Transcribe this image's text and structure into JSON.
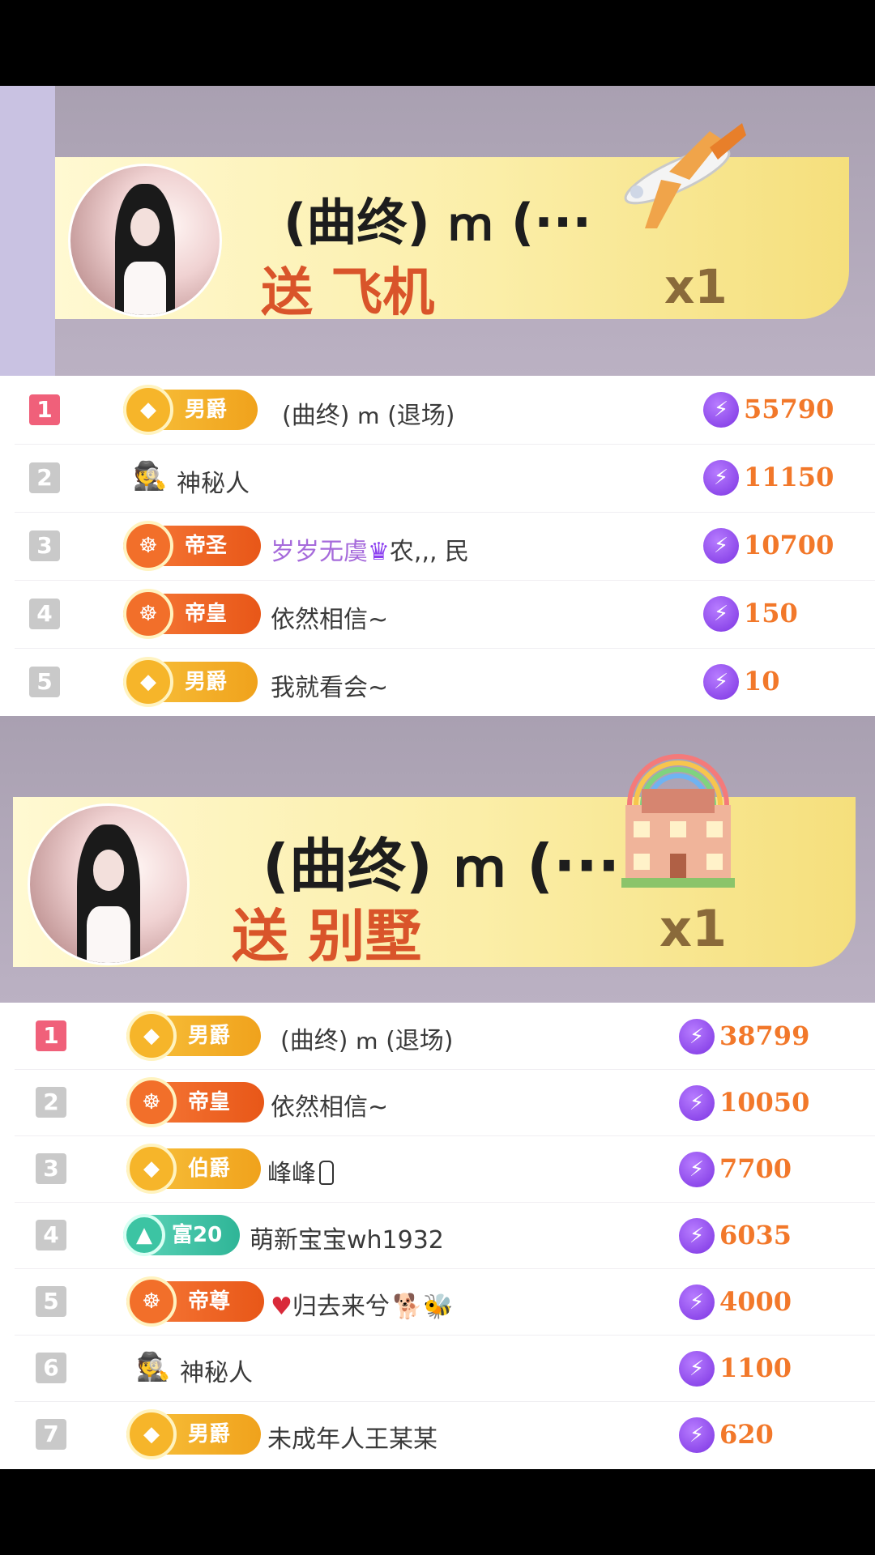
{
  "banners": [
    {
      "title": "(曲终) ՠ (···",
      "send_text": "送 飞机",
      "count": "x1",
      "gift_icon": "airplane-gift"
    },
    {
      "title": "(曲终) ՠ (···",
      "send_text": "送 别墅",
      "count": "x1",
      "gift_icon": "villa-gift"
    }
  ],
  "list1": [
    {
      "rank": "1",
      "badge": "男爵",
      "badge_style": "gold",
      "name": "(曲终) ՠ (退场)",
      "score": "55790"
    },
    {
      "rank": "2",
      "badge": "",
      "badge_style": "spy",
      "name": "神秘人",
      "score": "11150"
    },
    {
      "rank": "3",
      "badge": "帝圣",
      "badge_style": "orange",
      "name": "岁岁无虞",
      "name_suffix": "农,,, 民",
      "score": "10700"
    },
    {
      "rank": "4",
      "badge": "帝皇",
      "badge_style": "orange",
      "name": "依然相信~",
      "score": "150"
    },
    {
      "rank": "5",
      "badge": "男爵",
      "badge_style": "gold",
      "name": "我就看会~",
      "score": "10"
    }
  ],
  "list2": [
    {
      "rank": "1",
      "badge": "男爵",
      "badge_style": "gold",
      "name": "(曲终) ՠ (退场)",
      "score": "38799"
    },
    {
      "rank": "2",
      "badge": "帝皇",
      "badge_style": "orange",
      "name": "依然相信~",
      "score": "10050"
    },
    {
      "rank": "3",
      "badge": "伯爵",
      "badge_style": "gold",
      "name": "峰峰",
      "score": "7700"
    },
    {
      "rank": "4",
      "badge": "富20",
      "badge_style": "teal",
      "name": "萌新宝宝wh1932",
      "score": "6035"
    },
    {
      "rank": "5",
      "badge": "帝尊",
      "badge_style": "orange",
      "name": "归去来兮",
      "score": "4000"
    },
    {
      "rank": "6",
      "badge": "",
      "badge_style": "spy",
      "name": "神秘人",
      "score": "1100"
    },
    {
      "rank": "7",
      "badge": "男爵",
      "badge_style": "gold",
      "name": "未成年人王某某",
      "score": "620"
    }
  ],
  "colors": {
    "accent": "#f2782a",
    "send": "#d9542a",
    "bolt": "#7c34e2"
  }
}
